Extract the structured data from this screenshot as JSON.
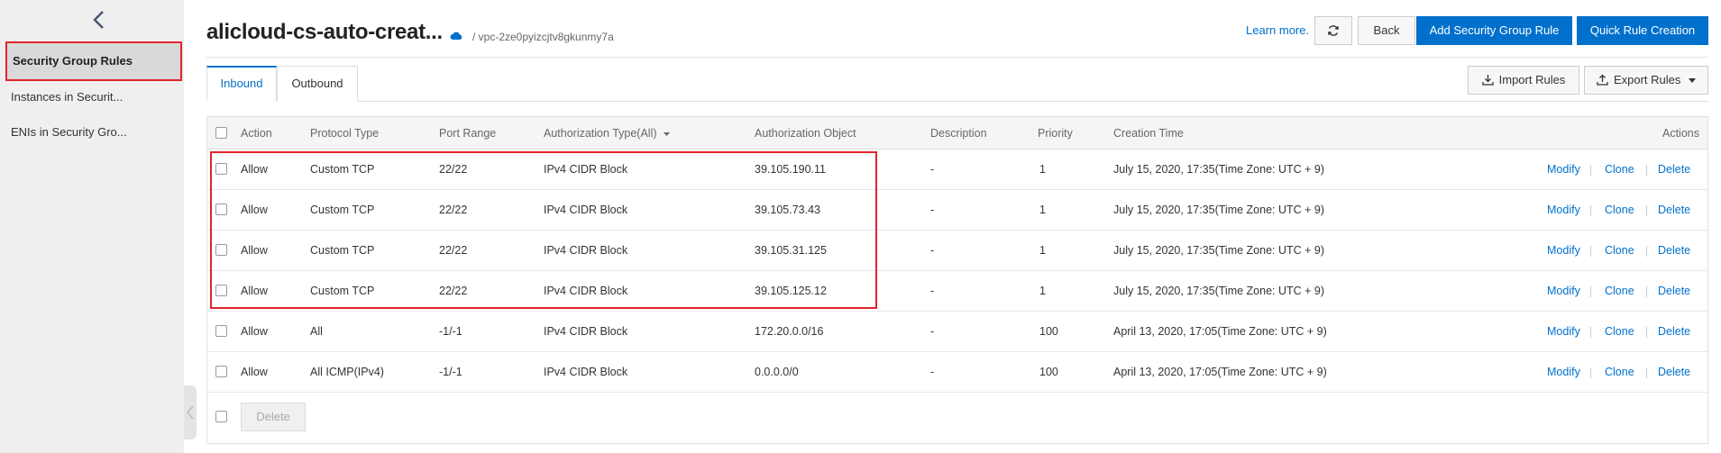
{
  "sidebar": {
    "items": [
      {
        "label": "Security Group Rules"
      },
      {
        "label": "Instances in Securit..."
      },
      {
        "label": "ENIs in Security Gro..."
      }
    ]
  },
  "header": {
    "title": "alicloud-cs-auto-creat...",
    "vpc": "/ vpc-2ze0pyizcjtv8gkunmy7a",
    "learn_more": "Learn more.",
    "back_label": "Back",
    "add_rule_label": "Add Security Group Rule",
    "quick_rule_label": "Quick Rule Creation"
  },
  "tabs": [
    {
      "label": "Inbound",
      "active": true
    },
    {
      "label": "Outbound",
      "active": false
    }
  ],
  "toolbar": {
    "import_label": "Import Rules",
    "export_label": "Export Rules"
  },
  "table": {
    "headers": {
      "action": "Action",
      "protocol": "Protocol Type",
      "port": "Port Range",
      "auth_type": "Authorization Type(All)",
      "auth_object": "Authorization Object",
      "description": "Description",
      "priority": "Priority",
      "created": "Creation Time",
      "actions": "Actions"
    },
    "rows": [
      {
        "action": "Allow",
        "protocol": "Custom TCP",
        "port": "22/22",
        "auth_type": "IPv4 CIDR Block",
        "auth_object": "39.105.190.11",
        "description": "-",
        "priority": "1",
        "created": "July 15, 2020, 17:35(Time Zone: UTC + 9)"
      },
      {
        "action": "Allow",
        "protocol": "Custom TCP",
        "port": "22/22",
        "auth_type": "IPv4 CIDR Block",
        "auth_object": "39.105.73.43",
        "description": "-",
        "priority": "1",
        "created": "July 15, 2020, 17:35(Time Zone: UTC + 9)"
      },
      {
        "action": "Allow",
        "protocol": "Custom TCP",
        "port": "22/22",
        "auth_type": "IPv4 CIDR Block",
        "auth_object": "39.105.31.125",
        "description": "-",
        "priority": "1",
        "created": "July 15, 2020, 17:35(Time Zone: UTC + 9)"
      },
      {
        "action": "Allow",
        "protocol": "Custom TCP",
        "port": "22/22",
        "auth_type": "IPv4 CIDR Block",
        "auth_object": "39.105.125.12",
        "description": "-",
        "priority": "1",
        "created": "July 15, 2020, 17:35(Time Zone: UTC + 9)"
      },
      {
        "action": "Allow",
        "protocol": "All",
        "port": "-1/-1",
        "auth_type": "IPv4 CIDR Block",
        "auth_object": "172.20.0.0/16",
        "description": "-",
        "priority": "100",
        "created": "April 13, 2020, 17:05(Time Zone: UTC + 9)"
      },
      {
        "action": "Allow",
        "protocol": "All ICMP(IPv4)",
        "port": "-1/-1",
        "auth_type": "IPv4 CIDR Block",
        "auth_object": "0.0.0.0/0",
        "description": "-",
        "priority": "100",
        "created": "April 13, 2020, 17:05(Time Zone: UTC + 9)"
      }
    ],
    "row_actions": {
      "modify": "Modify",
      "clone": "Clone",
      "delete": "Delete"
    },
    "footer": {
      "delete_label": "Delete"
    }
  },
  "colors": {
    "accent": "#0070cc",
    "highlight": "#e0242b"
  }
}
